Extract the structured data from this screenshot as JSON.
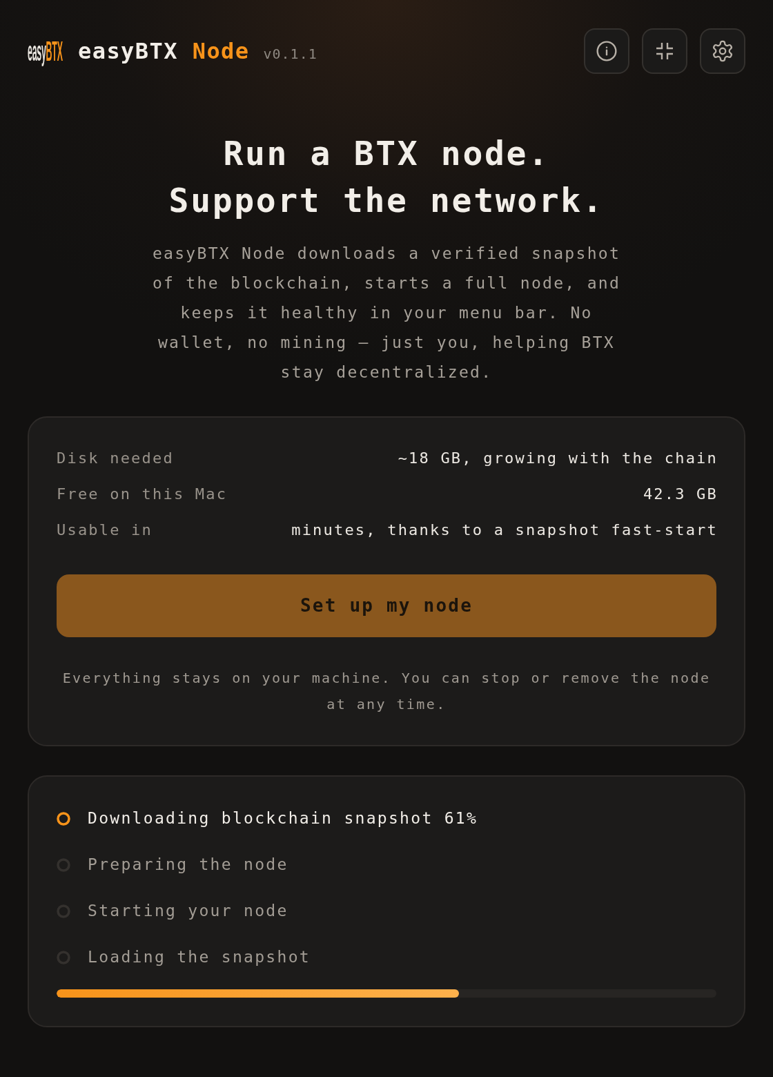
{
  "header": {
    "logo": {
      "main": "easy",
      "accent": "BTX"
    },
    "app_name": {
      "main": "easyBTX",
      "accent": "Node"
    },
    "version": "v0.1.1",
    "buttons": [
      {
        "kind": "info"
      },
      {
        "kind": "minimize"
      },
      {
        "kind": "settings"
      }
    ]
  },
  "hero": {
    "title_lines": [
      "Run a BTX node.",
      "Support the network."
    ],
    "description": "easyBTX Node downloads a verified snapshot of the blockchain, starts a full node, and keeps it healthy in your menu bar. No wallet, no mining — just you, helping BTX stay decentralized."
  },
  "setup_card": {
    "rows": [
      {
        "label": "Disk needed",
        "value": "~18 GB, growing with the chain"
      },
      {
        "label": "Free on this Mac",
        "value": "42.3 GB"
      },
      {
        "label": "Usable in",
        "value": "minutes, thanks to a snapshot fast-start"
      }
    ],
    "button": "Set up my node",
    "note": "Everything stays on your machine. You can stop or remove the node at any time."
  },
  "progress_card": {
    "steps": [
      {
        "label": "Downloading blockchain snapshot 61%",
        "active": true
      },
      {
        "label": "Preparing the node",
        "active": false
      },
      {
        "label": "Starting your node",
        "active": false
      },
      {
        "label": "Loading the snapshot",
        "active": false
      }
    ],
    "progress": {
      "level": 0.61
    }
  }
}
